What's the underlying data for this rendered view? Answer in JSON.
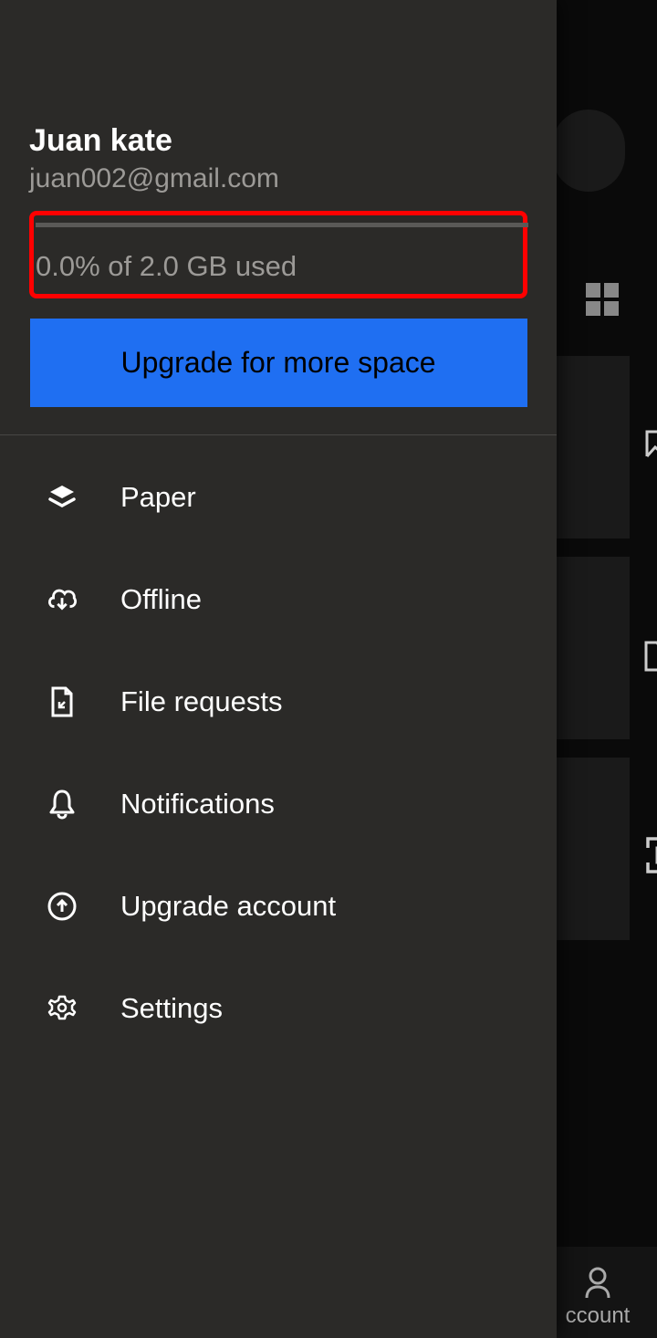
{
  "user": {
    "name": "Juan kate",
    "email": "juan002@gmail.com",
    "storage_text": "0.0% of 2.0 GB used",
    "storage_percent": 0.0
  },
  "upgrade_button": "Upgrade for more space",
  "menu": {
    "items": [
      {
        "label": "Paper",
        "icon": "layers-icon"
      },
      {
        "label": "Offline",
        "icon": "cloud-download-icon"
      },
      {
        "label": "File requests",
        "icon": "file-request-icon"
      },
      {
        "label": "Notifications",
        "icon": "bell-icon"
      },
      {
        "label": "Upgrade account",
        "icon": "arrow-up-circle-icon"
      },
      {
        "label": "Settings",
        "icon": "gear-icon"
      }
    ]
  },
  "background": {
    "bottom_nav_label": "ccount"
  },
  "highlight": {
    "target": "storage-usage",
    "color": "#ff0000"
  }
}
